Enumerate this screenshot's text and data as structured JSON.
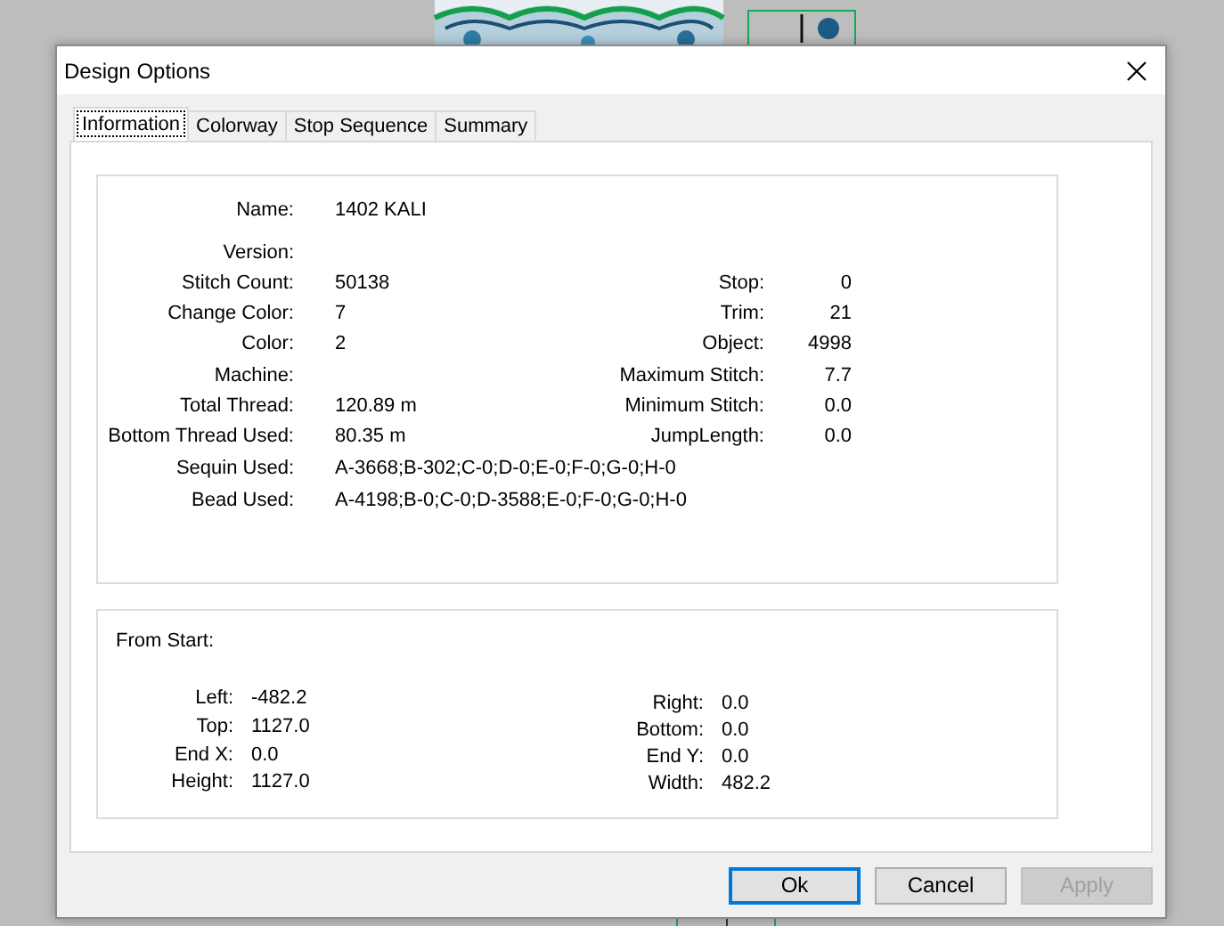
{
  "window": {
    "title": "Design Options"
  },
  "tabs": [
    {
      "label": "Information",
      "selected": true
    },
    {
      "label": "Colorway",
      "selected": false
    },
    {
      "label": "Stop Sequence",
      "selected": false
    },
    {
      "label": "Summary",
      "selected": false
    }
  ],
  "information": {
    "rows": [
      {
        "label": "Name:",
        "value": "1402 KALI"
      },
      {
        "label": "Version:"
      },
      {
        "label": "Stitch Count:",
        "value": "50138",
        "stat_label": "Stop:",
        "stat_value": "0"
      },
      {
        "label": "Change Color:",
        "value": "7",
        "stat_label": "Trim:",
        "stat_value": "21"
      },
      {
        "label": "Color:",
        "value": "2",
        "stat_label": "Object:",
        "stat_value": "4998"
      },
      {
        "label": "Machine:",
        "stat_label": "Maximum Stitch:",
        "stat_value": "7.7"
      },
      {
        "label": "Total Thread:",
        "value": "120.89 m",
        "stat_label": "Minimum Stitch:",
        "stat_value": "0.0"
      },
      {
        "label": "Bottom Thread Used:",
        "value": "80.35 m",
        "stat_label": "JumpLength:",
        "stat_value": "0.0"
      },
      {
        "label": "Sequin Used:",
        "value": "A-3668;B-302;C-0;D-0;E-0;F-0;G-0;H-0"
      },
      {
        "label": "Bead Used:",
        "value": "A-4198;B-0;C-0;D-3588;E-0;F-0;G-0;H-0"
      }
    ]
  },
  "from_start": {
    "title": "From Start:",
    "left": [
      {
        "label": "Left:",
        "value": "-482.2"
      },
      {
        "label": "Top:",
        "value": "1127.0"
      },
      {
        "label": "End X:",
        "value": "0.0"
      },
      {
        "label": "Height:",
        "value": "1127.0"
      }
    ],
    "right": [
      {
        "label": "Right:",
        "value": "0.0"
      },
      {
        "label": "Bottom:",
        "value": "0.0"
      },
      {
        "label": "End Y:",
        "value": "0.0"
      },
      {
        "label": "Width:",
        "value": "482.2"
      }
    ]
  },
  "buttons": [
    {
      "label": "Ok",
      "default": true,
      "disabled": false
    },
    {
      "label": "Cancel",
      "default": false,
      "disabled": false
    },
    {
      "label": "Apply",
      "default": false,
      "disabled": true
    }
  ]
}
